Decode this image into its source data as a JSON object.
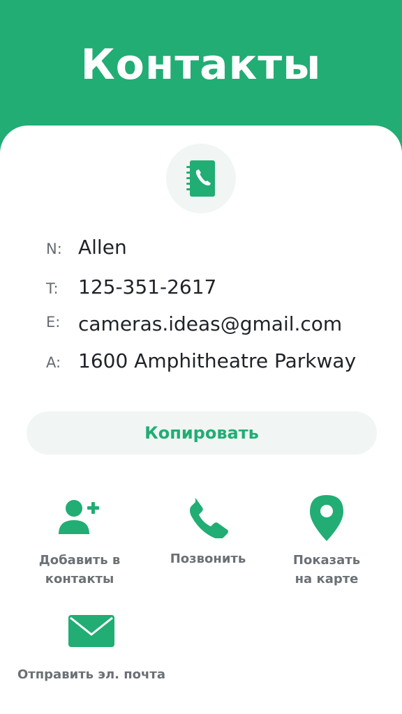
{
  "header": {
    "title": "Контакты"
  },
  "contact": {
    "name_label": "N:",
    "name": "Allen",
    "phone_label": "T:",
    "phone": "125-351-2617",
    "email_label": "E:",
    "email": "cameras.ideas@gmail.com",
    "address_label": "A:",
    "address": "1600 Amphitheatre Parkway"
  },
  "copy": {
    "label": "Копировать"
  },
  "actions": {
    "add_contact": {
      "line1": "Добавить в",
      "line2": "контакты",
      "icon": "add-person-icon"
    },
    "call": {
      "label": "Позвонить",
      "icon": "phone-icon"
    },
    "map": {
      "line1": "Показать",
      "line2": "на карте",
      "icon": "location-pin-icon"
    },
    "email": {
      "label": "Отправить эл. почта",
      "icon": "envelope-icon"
    }
  },
  "colors": {
    "accent": "#21ad74",
    "soft_bg": "#f1f5f3",
    "text": "#1f2328",
    "muted": "#6b7075"
  }
}
